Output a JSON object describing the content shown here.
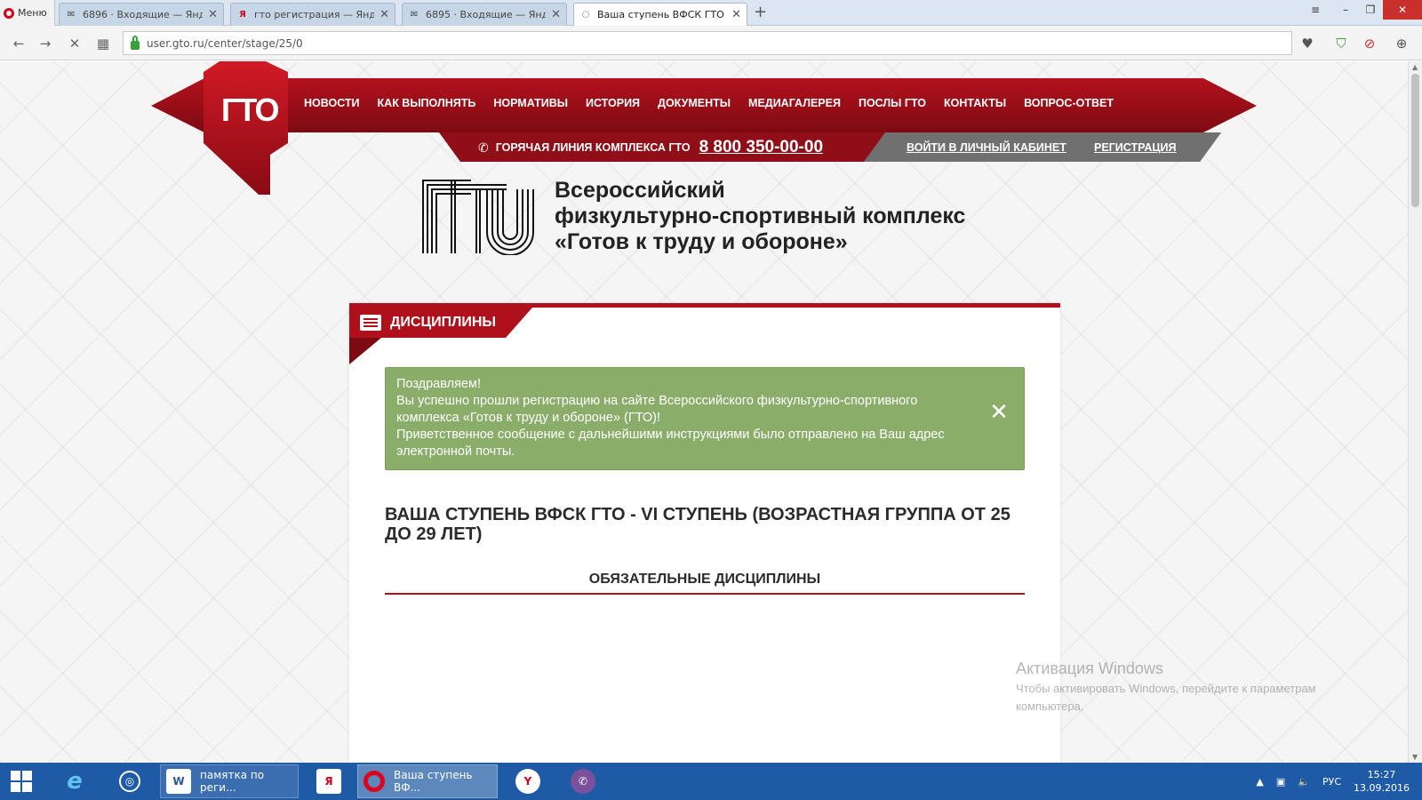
{
  "browser": {
    "menu_label": "Меню",
    "tabs": [
      {
        "label": "6896 · Входящие — Яндекс",
        "icon": "mail-icon"
      },
      {
        "label": "гто регистрация — Яндекс",
        "icon": "yandex-icon"
      },
      {
        "label": "6895 · Входящие — Яндекс",
        "icon": "mail-icon"
      },
      {
        "label": "Ваша ступень ВФСК ГТО ·",
        "icon": "loading-icon"
      }
    ],
    "new_tab": "+",
    "url": "user.gto.ru/center/stage/25/0"
  },
  "header": {
    "logo_text": "ГТО",
    "nav": [
      "НОВОСТИ",
      "КАК ВЫПОЛНЯТЬ",
      "НОРМАТИВЫ",
      "ИСТОРИЯ",
      "ДОКУМЕНТЫ",
      "МЕДИАГАЛЕРЕЯ",
      "ПОСЛЫ ГТО",
      "КОНТАКТЫ",
      "ВОПРОС-ОТВЕТ"
    ],
    "hotline_label": "ГОРЯЧАЯ ЛИНИЯ КОМПЛЕКСА ГТО",
    "hotline_phone": "8 800 350-00-00",
    "login": "ВОЙТИ В ЛИЧНЫЙ КАБИНЕТ",
    "register": "РЕГИСТРАЦИЯ",
    "accent_color": "#b0101b"
  },
  "title_block": {
    "logo_text": "ГТО",
    "line1": "Всероссийский",
    "line2": "физкультурно-спортивный комплекс",
    "line3": "«Готов к труду и обороне»"
  },
  "panel": {
    "tab_label": "ДИСЦИПЛИНЫ",
    "alert": {
      "line1": "Поздравляем!",
      "line2": "Вы успешно прошли регистрацию на сайте Всероссийского физкультурно-спортивного комплекса «Готов к труду и обороне» (ГТО)!",
      "line3": "Приветственное сообщение с дальнейшими инструкциями было отправлено на Ваш адрес электронной почты.",
      "close": "✕",
      "color": "#8aad6a"
    },
    "stage_heading": "ВАША СТУПЕНЬ ВФСК ГТО - VI СТУПЕНЬ (ВОЗРАСТНАЯ ГРУППА ОТ 25 ДО 29 ЛЕТ)",
    "mandatory_heading": "ОБЯЗАТЕЛЬНЫЕ ДИСЦИПЛИНЫ"
  },
  "watermark": {
    "title": "Активация Windows",
    "text": "Чтобы активировать Windows, перейдите к параметрам компьютера."
  },
  "taskbar": {
    "apps": [
      {
        "label": "памятка по реги...",
        "icon": "word-icon"
      },
      {
        "label": "Ваша ступень ВФ...",
        "icon": "opera-icon"
      }
    ],
    "language": "РУС",
    "time": "15:27",
    "date": "13.09.2016"
  }
}
